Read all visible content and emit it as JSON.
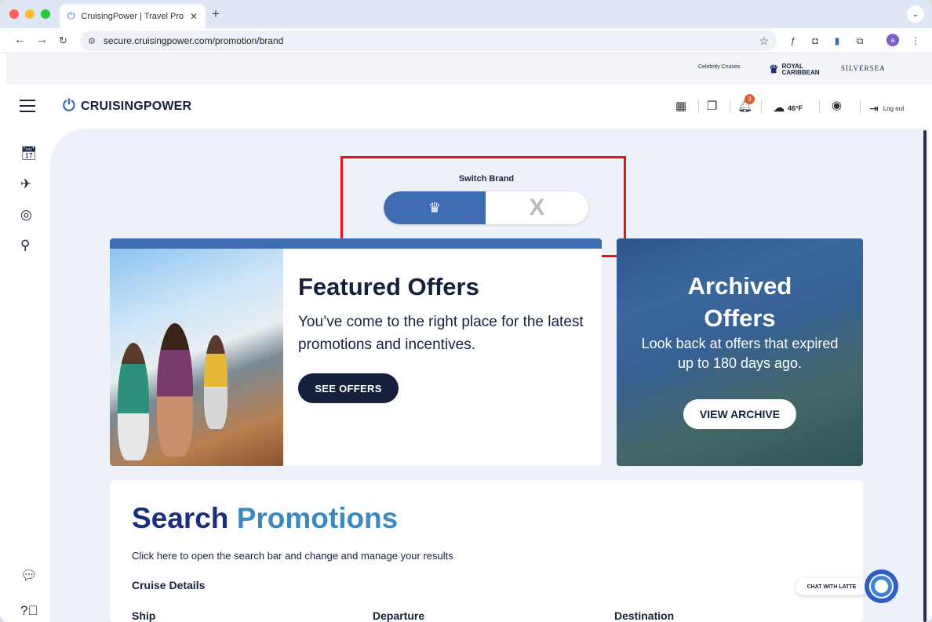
{
  "browser": {
    "tab_title": "CruisingPower | Travel Profes",
    "tab_close": "✕",
    "new_tab": "+",
    "url": "secure.cruisingpower.com/promotion/brand",
    "profile_initial": "a"
  },
  "brands": {
    "celebrity": "Celebrity Cruises",
    "royal": "ROYAL CARIBBEAN",
    "silversea": "SILVERSEA"
  },
  "header": {
    "logo_text": "CRUISINGPOWER",
    "notification_count": "3",
    "temperature": "46°F",
    "logout_label": "Log out"
  },
  "switch_brand": {
    "title": "Switch Brand",
    "active_brand_icon": "royal-caribbean-crown-anchor-icon",
    "inactive_brand_icon": "celebrity-x-icon",
    "inactive_glyph": "X"
  },
  "featured": {
    "title": "Featured Offers",
    "description": "You’ve come to the right place for the latest promotions and incentives.",
    "button": "SEE OFFERS"
  },
  "archived": {
    "title": "Archived Offers",
    "description": "Look back at offers that expired up to 180 days ago.",
    "button": "VIEW ARCHIVE"
  },
  "search": {
    "title_part1": "Search ",
    "title_part2": "Promotions",
    "subtitle": "Click here to open the search bar and change and manage your results",
    "section": "Cruise Details",
    "columns": [
      "Ship",
      "Departure",
      "Destination"
    ]
  },
  "chat": {
    "label": "CHAT WITH LATTE"
  },
  "colors": {
    "accent": "#3e6bb2",
    "navy": "#15203d",
    "highlight": "#ee1111"
  }
}
